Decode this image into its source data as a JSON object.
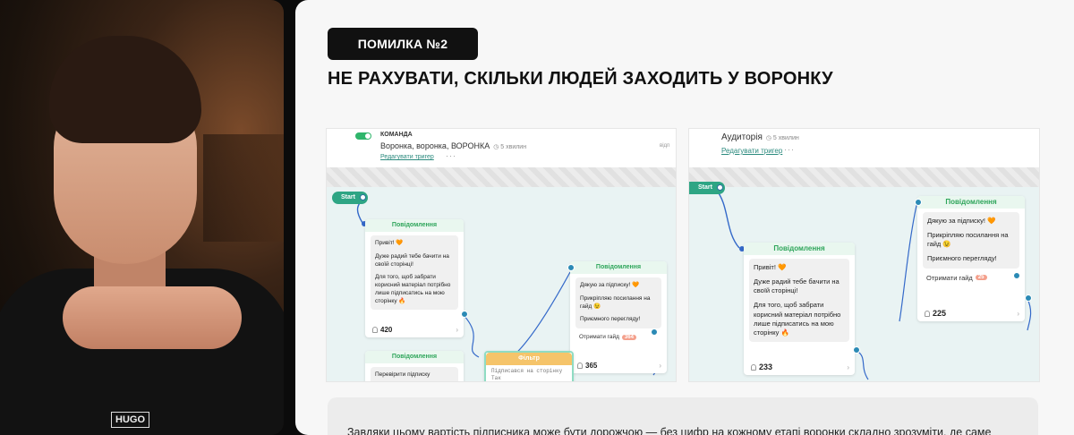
{
  "slide": {
    "badge": "ПОМИЛКА №2",
    "title": "НЕ РАХУВАТИ, СКІЛЬКИ ЛЮДЕЙ ЗАХОДИТЬ У ВОРОНКУ",
    "note": "Завдяки цьому вартість підписника може бути дорожчою — без цифр на кожному етапі воронки складно зрозуміти, де саме"
  },
  "webcam": {
    "shirt_logo": "HUGO"
  },
  "shot1": {
    "team": "КОМАНДА",
    "name": "Воронка, воронка, ВОРОНКА",
    "time": "◷ 5 хвилин",
    "edit": "Редагувати тригер",
    "side": "відп",
    "start": "Start",
    "msg1": {
      "header": "Повідомлення",
      "lines": [
        "Привіт! 🧡",
        "Дуже радий тебе бачити на своїй сторінці!",
        "Для того, щоб забрати корисний матеріал потрібно лише підписатись на мою сторінку 🔥"
      ],
      "count": "420"
    },
    "msg2": {
      "header": "Повідомлення",
      "lines": [
        "Дякую за підписку! 🧡",
        "Прикріпляю посилання на гайд 😉",
        "Приємного перегляду!"
      ],
      "button": "Отримати гайд",
      "button_badge": "364",
      "count": "365"
    },
    "msg3": {
      "header": "Повідомлення",
      "line": "Перевірити підписку"
    },
    "filter": {
      "header": "Фільтр",
      "line1": "Підписався на сторінку",
      "line2": "Так"
    }
  },
  "shot2": {
    "name": "Аудиторія",
    "time": "◷ 5 хвилин",
    "edit": "Редагувати тригер",
    "start": "Start",
    "msg1": {
      "header": "Повідомлення",
      "lines": [
        "Привіт! 🧡",
        "Дуже радий тебе бачити на своїй сторінці!",
        "Для того, щоб забрати корисний матеріал потрібно лише підписатись на мою сторінку 🔥"
      ],
      "count": "233"
    },
    "msg2": {
      "header": "Повідомлення",
      "lines": [
        "Дякую за підписку! 🧡",
        "Прикріпляю посилання на гайд 😉",
        "Приємного перегляду!"
      ],
      "button": "Отримати гайд",
      "button_badge": "25",
      "count": "225"
    }
  },
  "colors": {
    "accent": "#2ea584",
    "badge_bg": "#111111",
    "wire": "#3469c9"
  },
  "icons": [
    "clock-icon",
    "user-icon",
    "chevron-right-icon",
    "more-dots-icon"
  ]
}
